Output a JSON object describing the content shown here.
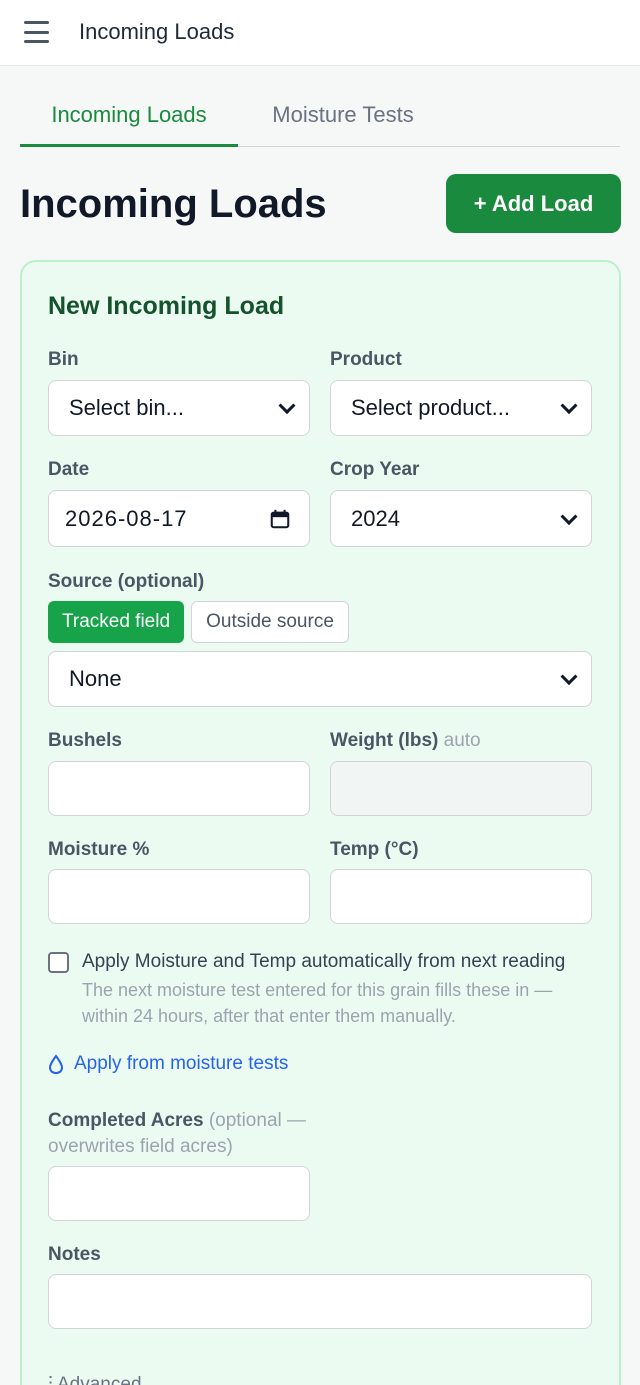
{
  "topbar": {
    "title": "Incoming Loads"
  },
  "tabs": [
    {
      "label": "Incoming Loads",
      "active": true
    },
    {
      "label": "Moisture Tests",
      "active": false
    }
  ],
  "page": {
    "title": "Incoming Loads",
    "add_button": "+ Add Load"
  },
  "form": {
    "title": "New Incoming Load",
    "bin": {
      "label": "Bin",
      "value": "Select bin..."
    },
    "product": {
      "label": "Product",
      "value": "Select product..."
    },
    "date": {
      "label": "Date",
      "value": "2026-08-17"
    },
    "crop_year": {
      "label": "Crop Year",
      "value": "2024"
    },
    "source": {
      "label": "Source (optional)",
      "options": [
        "Tracked field",
        "Outside source"
      ],
      "selected_option": "Tracked field",
      "value": "None"
    },
    "bushels": {
      "label": "Bushels",
      "value": ""
    },
    "weight": {
      "label": "Weight (lbs)",
      "hint": "auto",
      "value": ""
    },
    "moisture": {
      "label": "Moisture %",
      "value": ""
    },
    "temp": {
      "label": "Temp (°C)",
      "value": ""
    },
    "auto_apply": {
      "label": "Apply Moisture and Temp automatically from next reading",
      "help": "The next moisture test entered for this grain fills these in — within 24 hours, after that enter them manually.",
      "checked": false
    },
    "apply_link": "Apply from moisture tests",
    "completed_acres": {
      "label": "Completed Acres",
      "hint": "(optional — overwrites field acres)",
      "value": ""
    },
    "notes": {
      "label": "Notes",
      "value": ""
    },
    "advanced": "Advanced"
  },
  "colors": {
    "accent": "#1a8a3e",
    "segment_on": "#16a34a",
    "link": "#2563eb",
    "card_bg": "#ecfbf1"
  }
}
